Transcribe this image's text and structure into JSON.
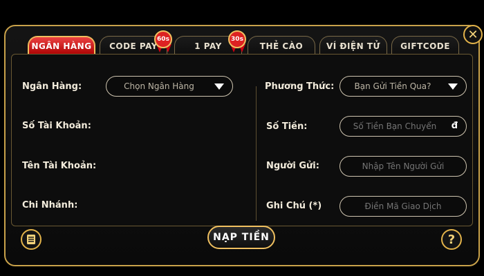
{
  "tabs": [
    {
      "label": "NGÂN HÀNG",
      "active": true
    },
    {
      "label": "CODE PAY",
      "badge": "60s"
    },
    {
      "label": "1 PAY",
      "badge": "30s"
    },
    {
      "label": "THẺ CÀO"
    },
    {
      "label": "VÍ ĐIỆN TỬ"
    },
    {
      "label": "GIFTCODE"
    }
  ],
  "left_form": {
    "bank_label": "Ngân Hàng:",
    "bank_select": "Chọn Ngân Hàng",
    "account_number_label": "Số Tài Khoản:",
    "account_name_label": "Tên Tài Khoản:",
    "branch_label": "Chi Nhánh:"
  },
  "right_form": {
    "method_label": "Phương Thức:",
    "method_select": "Bạn Gửi Tiền Qua?",
    "amount_label": "Số Tiền:",
    "amount_placeholder": "Số Tiền Bạn Chuyển",
    "currency_symbol": "đ",
    "sender_label": "Người Gửi:",
    "sender_placeholder": "Nhập Tên Người Gửi",
    "note_label": "Ghi Chú (*)",
    "note_placeholder": "Điền Mã Giao Dịch"
  },
  "actions": {
    "submit_label": "NẠP TIỀN",
    "help_glyph": "?",
    "close_glyph": "✕"
  },
  "icons": {
    "close": "close-icon",
    "history": "document-list-icon",
    "help": "question-icon"
  },
  "colors": {
    "accent_gold": "#c9a24a",
    "active_tab_red": "#cc1111"
  }
}
